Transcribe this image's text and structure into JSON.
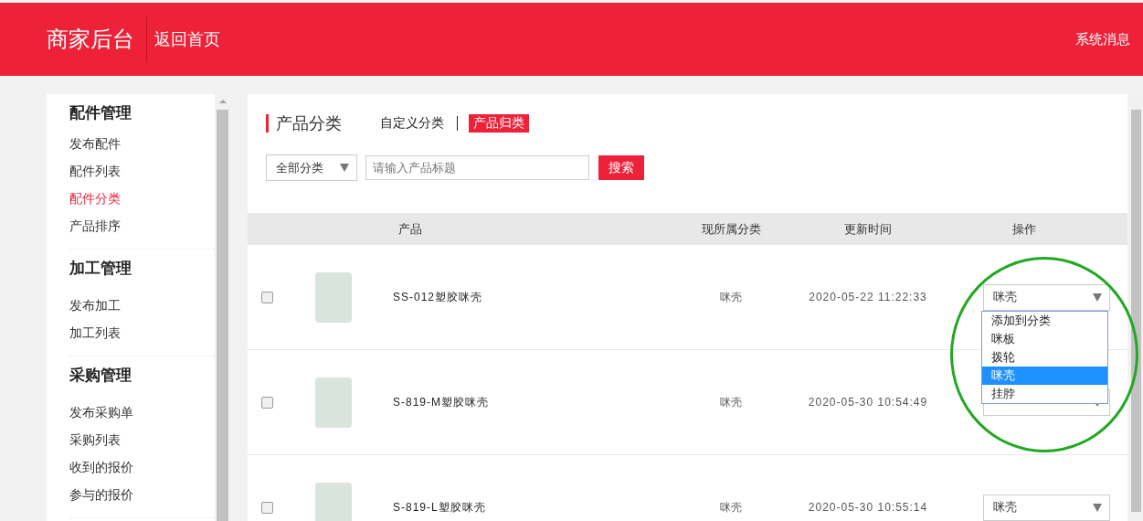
{
  "header": {
    "logo": "商家后台",
    "home_link": "返回首页",
    "messages_link": "系统消息"
  },
  "sidebar": {
    "groups": [
      {
        "title": "配件管理",
        "items": [
          {
            "label": "发布配件",
            "selected": false
          },
          {
            "label": "配件列表",
            "selected": false
          },
          {
            "label": "配件分类",
            "selected": true
          },
          {
            "label": "产品排序",
            "selected": false
          }
        ]
      },
      {
        "title": "加工管理",
        "items": [
          {
            "label": "发布加工",
            "selected": false
          },
          {
            "label": "加工列表",
            "selected": false
          }
        ]
      },
      {
        "title": "采购管理",
        "items": [
          {
            "label": "发布采购单",
            "selected": false
          },
          {
            "label": "采购列表",
            "selected": false
          },
          {
            "label": "收到的报价",
            "selected": false
          },
          {
            "label": "参与的报价",
            "selected": false
          }
        ]
      }
    ]
  },
  "page": {
    "title": "产品分类",
    "tabs": [
      {
        "label": "自定义分类",
        "selected": false
      },
      {
        "label": "产品归类",
        "selected": true
      }
    ]
  },
  "filter": {
    "category_select": "全部分类",
    "search": {
      "placeholder": "请输入产品标题"
    },
    "search_button": "搜索"
  },
  "table": {
    "columns": [
      "产品",
      "现所属分类",
      "更新时间",
      "操作"
    ],
    "rows": [
      {
        "checked": false,
        "product": "SS-012塑胶咪壳",
        "category": "咪壳",
        "updated": "2020-05-22 11:22:33",
        "action_select": "咪壳",
        "dropdown_options": [
          {
            "label": "添加到分类",
            "selected": false
          },
          {
            "label": "咪板",
            "selected": false
          },
          {
            "label": "拨轮",
            "selected": false
          },
          {
            "label": "咪壳",
            "selected": true
          },
          {
            "label": "挂脖",
            "selected": false
          }
        ]
      },
      {
        "checked": false,
        "product": "S-819-M塑胶咪壳",
        "category": "咪壳",
        "updated": "2020-05-30 10:54:49"
      },
      {
        "checked": false,
        "product": "S-819-L塑胶咪壳",
        "category": "咪壳",
        "updated": "2020-05-30 10:55:14",
        "action_select": "咪壳"
      }
    ]
  },
  "annotations": [
    {
      "kind": "circle",
      "color": "#22a822"
    }
  ]
}
